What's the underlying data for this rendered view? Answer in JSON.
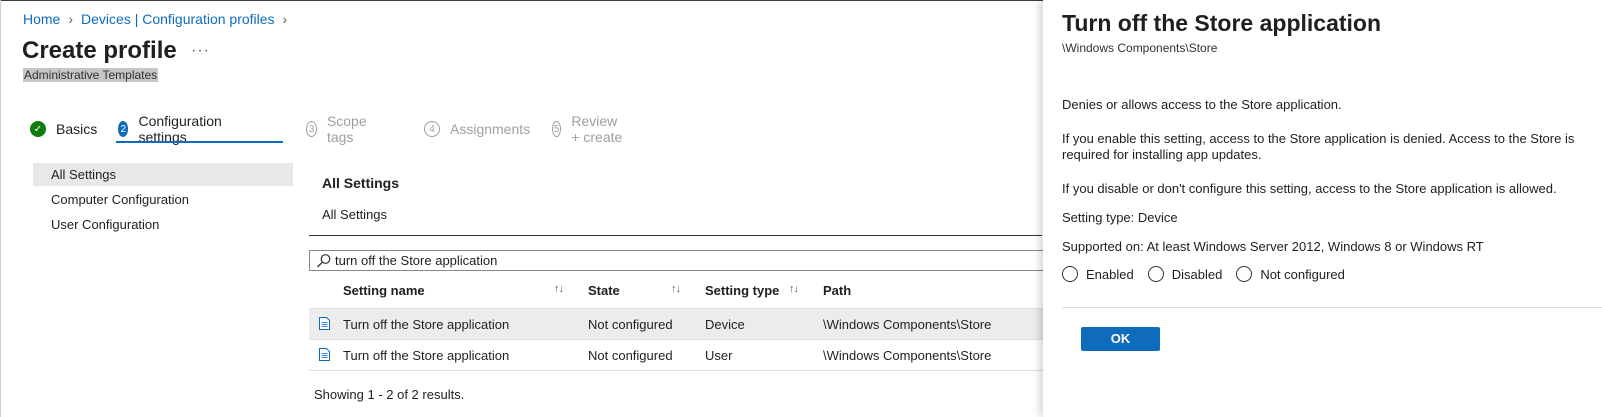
{
  "breadcrumb": {
    "home": "Home",
    "devices": "Devices | Configuration profiles"
  },
  "page": {
    "title": "Create profile",
    "more": "···",
    "subtitle": "Administrative Templates"
  },
  "wizard": {
    "steps": [
      {
        "num": "✓",
        "label": "Basics",
        "state": "done"
      },
      {
        "num": "2",
        "label": "Configuration settings",
        "state": "active"
      },
      {
        "num": "3",
        "label": "Scope tags",
        "state": "future"
      },
      {
        "num": "4",
        "label": "Assignments",
        "state": "future"
      },
      {
        "num": "5",
        "label": "Review + create",
        "state": "future"
      }
    ]
  },
  "leftnav": {
    "items": [
      "All Settings",
      "Computer Configuration",
      "User Configuration"
    ]
  },
  "main": {
    "section_title": "All Settings",
    "section_sub": "All Settings",
    "search_value": "turn off the Store application",
    "columns": {
      "name": "Setting name",
      "state": "State",
      "type": "Setting type",
      "path": "Path"
    },
    "sort_glyph": "↑↓",
    "rows": [
      {
        "name": "Turn off the Store application",
        "state": "Not configured",
        "type": "Device",
        "path": "\\Windows Components\\Store"
      },
      {
        "name": "Turn off the Store application",
        "state": "Not configured",
        "type": "User",
        "path": "\\Windows Components\\Store"
      }
    ],
    "showing": "Showing 1 - 2 of 2 results."
  },
  "flyout": {
    "title": "Turn off the Store application",
    "path": "\\Windows Components\\Store",
    "desc1": "Denies or allows access to the Store application.",
    "desc2": "If you enable this setting, access to the Store application is denied. Access to the Store is required for installing app updates.",
    "desc3": "If you disable or don't configure this setting, access to the Store application is allowed.",
    "setting_type": "Setting type: Device",
    "supported": "Supported on: At least Windows Server 2012, Windows 8 or Windows RT",
    "options": [
      "Enabled",
      "Disabled",
      "Not configured"
    ],
    "ok": "OK"
  },
  "colors": {
    "accent": "#0f6cbd",
    "success": "#107c10"
  },
  "icons": {
    "search": "search-icon",
    "document": "document-icon",
    "chevron": "chevron-right-icon"
  }
}
